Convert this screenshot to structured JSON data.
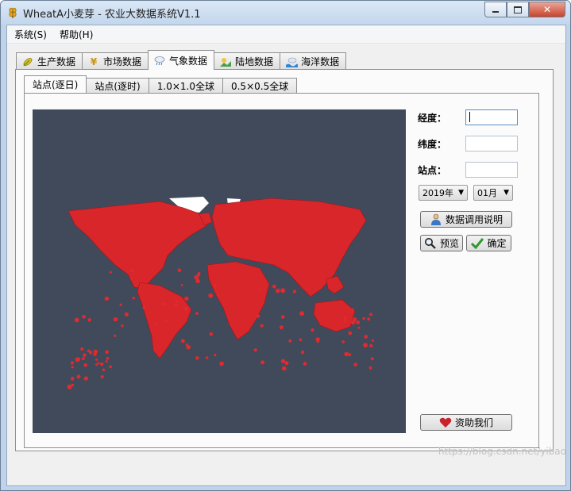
{
  "window": {
    "title": "WheatA小麦芽 - 农业大数据系统V1.1",
    "controls": {
      "minimize": "minimize-icon",
      "maximize": "maximize-icon",
      "close": "close-icon"
    }
  },
  "menu": [
    "系统(S)",
    "帮助(H)"
  ],
  "outer_tabs": [
    {
      "label": "生产数据",
      "icon": "corn-icon"
    },
    {
      "label": "市场数据",
      "icon": "yen-icon"
    },
    {
      "label": "气象数据",
      "icon": "weather-icon",
      "active": true
    },
    {
      "label": "陆地数据",
      "icon": "land-icon"
    },
    {
      "label": "海洋数据",
      "icon": "ocean-icon"
    }
  ],
  "inner_tabs": [
    {
      "label": "站点(逐日)",
      "active": true
    },
    {
      "label": "站点(逐时)"
    },
    {
      "label": "1.0×1.0全球"
    },
    {
      "label": "0.5×0.5全球"
    }
  ],
  "form": {
    "longitude_label": "经度：",
    "latitude_label": "纬度：",
    "station_label": "站点：",
    "longitude_value": "",
    "latitude_value": "",
    "station_value": "",
    "year_select": "2019年",
    "month_select": "01月",
    "data_help_button": "数据调用说明",
    "preview_button": "预览",
    "confirm_button": "确定",
    "donate_button": "资助我们"
  },
  "colors": {
    "map_background": "#414a5a",
    "station_marks": "#d9262b",
    "polar_ice": "#ffffff"
  },
  "watermark": "https://blog.csdn.net/yibao"
}
